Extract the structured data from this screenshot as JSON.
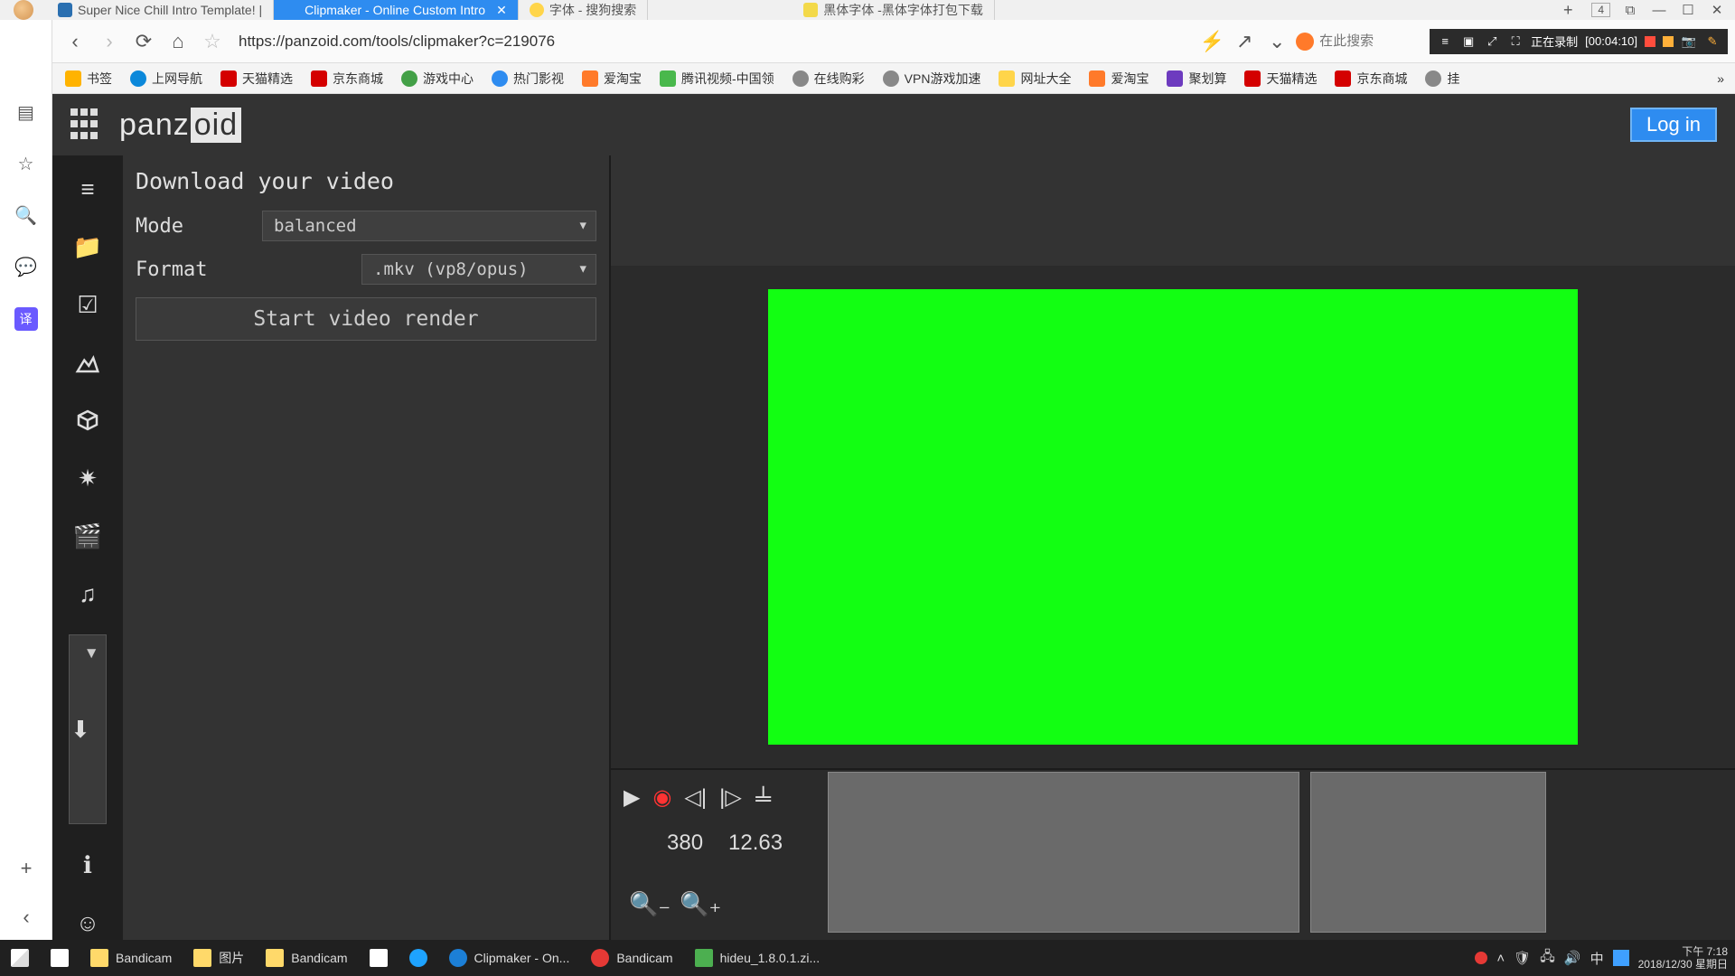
{
  "titlebar": {
    "tabs": [
      {
        "label": "Super Nice Chill Intro Template! |"
      },
      {
        "label": "Clipmaker - Online Custom Intro"
      },
      {
        "label": "字体 - 搜狗搜索"
      },
      {
        "label": "黑体字体 -黑体字体打包下载"
      }
    ],
    "close_glyph": "✕",
    "newtab_glyph": "+",
    "badge": "4",
    "ext_glyph": "⧉",
    "min_glyph": "—",
    "max_glyph": "☐",
    "x_glyph": "✕"
  },
  "addr": {
    "url": "https://panzoid.com/tools/clipmaker?c=219076",
    "search_placeholder": "在此搜索",
    "back": "‹",
    "fwd": "›",
    "reload": "⟳",
    "home": "⌂",
    "star": "☆",
    "amp": "⚡",
    "share": "↗",
    "drop": "⌄"
  },
  "rec": {
    "label": "正在录制",
    "time": "[00:04:10]",
    "i1": "≡",
    "i2": "▣",
    "i3": "⤢",
    "i4": "⛶",
    "cam": "📷",
    "pen": "✎"
  },
  "bookmarks": [
    {
      "label": "书签"
    },
    {
      "label": "上网导航"
    },
    {
      "label": "天猫精选"
    },
    {
      "label": "京东商城"
    },
    {
      "label": "游戏中心"
    },
    {
      "label": "热门影视"
    },
    {
      "label": "爱淘宝"
    },
    {
      "label": "腾讯视频-中国领"
    },
    {
      "label": "在线购彩"
    },
    {
      "label": "VPN游戏加速"
    },
    {
      "label": "网址大全"
    },
    {
      "label": "爱淘宝"
    },
    {
      "label": "聚划算"
    },
    {
      "label": "天猫精选"
    },
    {
      "label": "京东商城"
    },
    {
      "label": "挂"
    }
  ],
  "bk_more": "»",
  "leftstrip": {
    "reader": "▤",
    "star": "☆",
    "search": "🔍",
    "chat": "💬",
    "translate": "译",
    "plus": "+",
    "back": "‹"
  },
  "app": {
    "logo_left": "panz",
    "logo_fill": "oid",
    "login": "Log in",
    "panel_title": "Download your video",
    "mode_label": "Mode",
    "mode_value": "balanced",
    "format_label": "Format",
    "format_value": ".mkv (vp8/opus)",
    "render_btn": "Start video render",
    "timeline": {
      "frame": "380",
      "seconds": "12.63",
      "play": "▶",
      "eye": "◉",
      "prev": "◁|",
      "next": "|▷",
      "wave": "𝍦",
      "zoomout": "🔍₋",
      "zoomin": "🔍₊"
    },
    "icons": {
      "menu": "≡",
      "folder": "📁",
      "check": "☑",
      "img": "🖼",
      "cube": "⬚",
      "spark": "✷",
      "cam": "🎬",
      "music": "♫",
      "download": "⬇",
      "info": "ℹ",
      "smile": "☺"
    }
  },
  "taskbar": {
    "items": [
      {
        "label": ""
      },
      {
        "label": ""
      },
      {
        "label": "Bandicam"
      },
      {
        "label": "图片"
      },
      {
        "label": "Bandicam"
      },
      {
        "label": ""
      },
      {
        "label": ""
      },
      {
        "label": "Clipmaker - On..."
      },
      {
        "label": "Bandicam"
      },
      {
        "label": "hideu_1.8.0.1.zi..."
      }
    ],
    "ime": "中",
    "time": "下午 7:18",
    "date": "2018/12/30 星期日",
    "tray": {
      "up": "˄",
      "net": "🖧",
      "shield": "🛡",
      "vol": "🔊"
    }
  }
}
